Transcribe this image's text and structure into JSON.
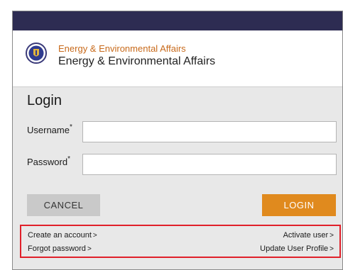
{
  "header": {
    "agency_top": "Energy & Environmental Affairs",
    "agency_main": "Energy & Environmental Affairs",
    "seal_icon": "massachusetts-seal-icon"
  },
  "login": {
    "title": "Login",
    "username_label": "Username",
    "password_label": "Password",
    "required_marker": "*",
    "username_value": "",
    "password_value": "",
    "cancel_label": "CANCEL",
    "login_label": "LOGIN"
  },
  "links": {
    "create_account": "Create an account",
    "forgot_password": "Forgot password",
    "activate_user": "Activate user",
    "update_profile": "Update User Profile",
    "chevron": ">"
  },
  "colors": {
    "topbar": "#2d2c52",
    "agency_accent": "#c86a1b",
    "login_button": "#e08a1e",
    "highlight_border": "#e0202a"
  }
}
